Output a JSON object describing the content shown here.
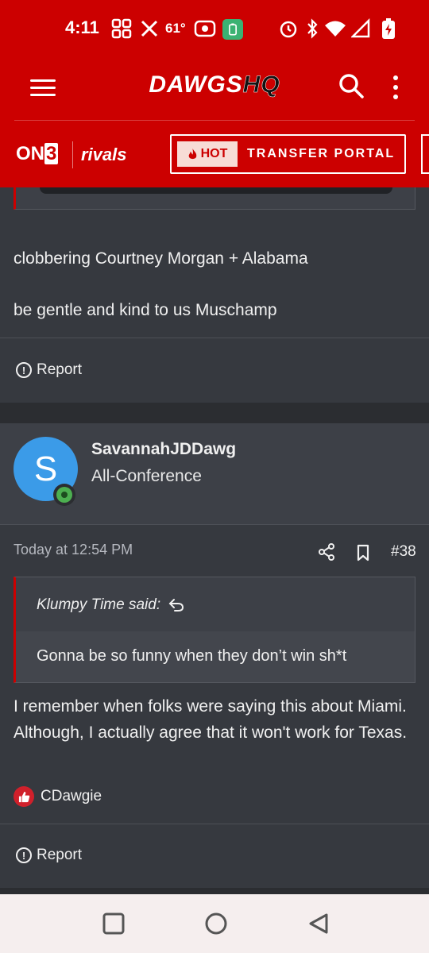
{
  "status_bar": {
    "time": "4:11",
    "temperature": "61°",
    "icons": [
      "grid-apps-icon",
      "x-logo-icon",
      "radio-icon",
      "battery-saver-icon",
      "alarm-icon",
      "bluetooth-icon",
      "wifi-icon",
      "signal-icon",
      "battery-charging-icon"
    ]
  },
  "header": {
    "logo_main": "DAWGS",
    "logo_accent": "HQ",
    "icons": [
      "menu-icon",
      "search-icon",
      "more-vert-icon"
    ]
  },
  "partners": {
    "on3_prefix": "ON",
    "on3_suffix": "3",
    "rivals": "rivals",
    "hot_badge": "HOT",
    "transfer_label": "TRANSFER PORTAL"
  },
  "post1": {
    "line1": "clobbering Courtney Morgan + Alabama",
    "line2": "be gentle and kind to us Muschamp",
    "report": "Report"
  },
  "post2": {
    "avatar_letter": "S",
    "username": "SavannahJDDawg",
    "user_title": "All-Conference",
    "date": "Today at 12:54 PM",
    "post_number": "#38",
    "quote_author": "Klumpy Time said:",
    "quote_text": "Gonna be so funny when they don’t win sh*t",
    "body": "I remember when folks were saying this about Miami. Although, I actually agree that it won't work for Texas.",
    "reaction_user": "CDawgie",
    "report": "Report"
  },
  "colors": {
    "brand_red": "#cc0000",
    "background": "#36393f",
    "avatar_blue": "#3b9be8",
    "online_green": "#4caf50"
  }
}
